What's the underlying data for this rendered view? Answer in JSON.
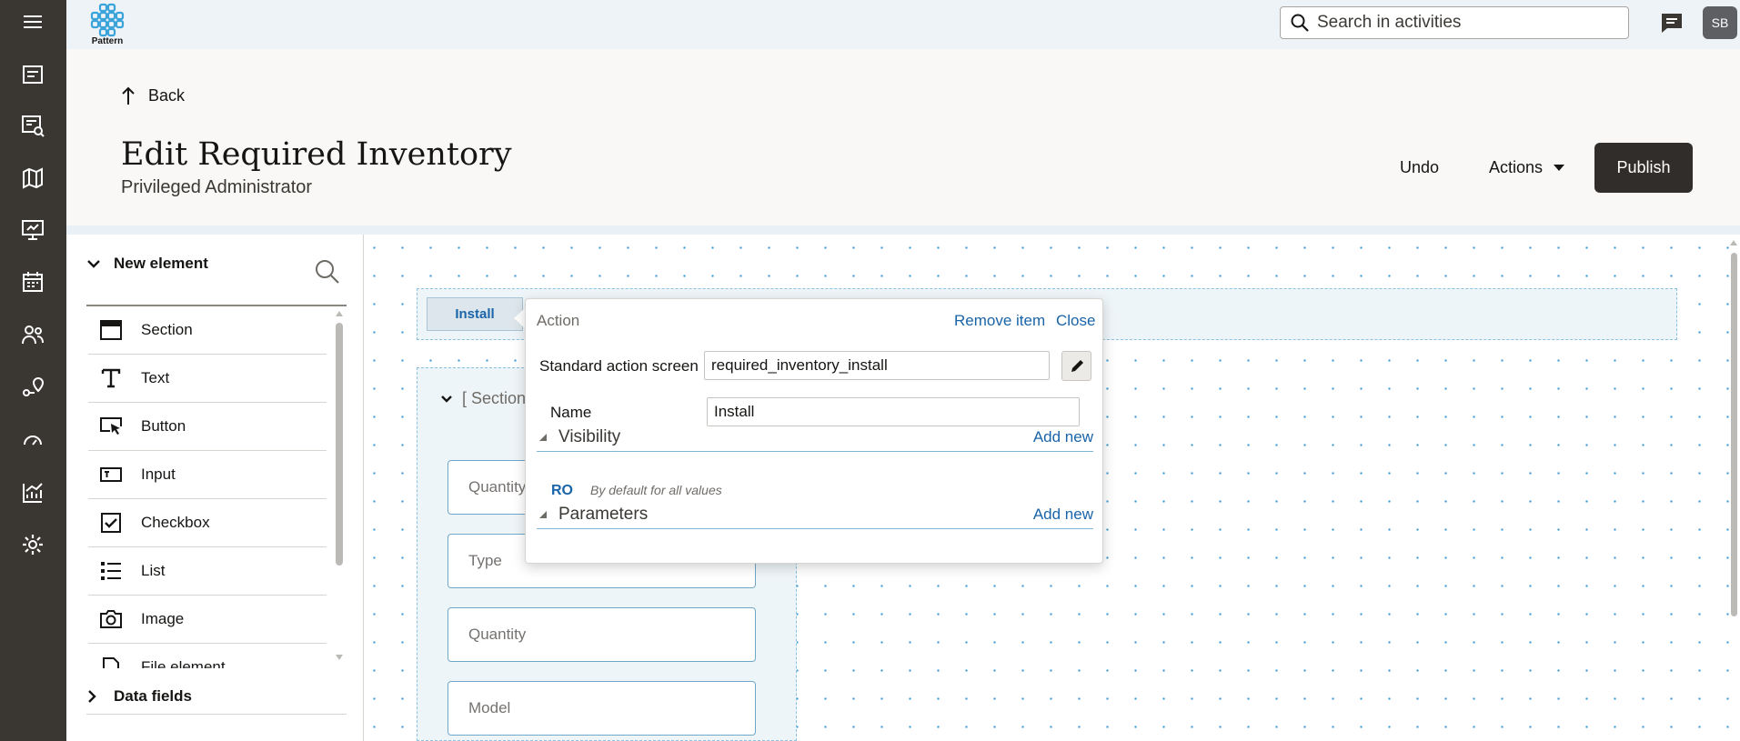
{
  "nav_rail": {
    "items": [
      {
        "icon": "hamburger-menu-icon"
      },
      {
        "icon": "activity-list-icon"
      },
      {
        "icon": "dispatch-search-icon"
      },
      {
        "icon": "map-icon"
      },
      {
        "icon": "presentation-icon"
      },
      {
        "icon": "calendar-icon"
      },
      {
        "icon": "resources-icon"
      },
      {
        "icon": "routing-icon"
      },
      {
        "icon": "gauge-icon"
      },
      {
        "icon": "analytics-icon"
      },
      {
        "icon": "settings-icon"
      }
    ]
  },
  "header": {
    "logo_text": "Pattern",
    "search_placeholder": "Search in activities",
    "avatar_initials": "SB"
  },
  "page": {
    "back_label": "Back",
    "title": "Edit Required Inventory",
    "subtitle": "Privileged Administrator",
    "undo_label": "Undo",
    "actions_label": "Actions",
    "publish_label": "Publish"
  },
  "palette": {
    "header": "New element",
    "items": [
      {
        "label": "Section",
        "icon": "section-icon"
      },
      {
        "label": "Text",
        "icon": "text-icon"
      },
      {
        "label": "Button",
        "icon": "button-icon"
      },
      {
        "label": "Input",
        "icon": "input-icon"
      },
      {
        "label": "Checkbox",
        "icon": "checkbox-icon"
      },
      {
        "label": "List",
        "icon": "list-icon"
      },
      {
        "label": "Image",
        "icon": "camera-icon"
      },
      {
        "label": "File element",
        "icon": "file-icon"
      }
    ],
    "data_fields_label": "Data fields"
  },
  "canvas": {
    "install_button_label": "Install",
    "section_header": "[ Section",
    "fields": [
      "Quantity",
      "Type",
      "Quantity",
      "Model"
    ]
  },
  "popup": {
    "title": "Action",
    "remove_label": "Remove item",
    "close_label": "Close",
    "standard_action_label": "Standard action screen",
    "standard_action_value": "required_inventory_install",
    "name_label": "Name",
    "name_value": "Install",
    "visibility_title": "Visibility",
    "parameters_title": "Parameters",
    "add_new_label": "Add new",
    "ro_label": "RO",
    "ro_description": "By default for all values"
  },
  "colors": {
    "rail": "#3a3632",
    "accent_link": "#1a64a8",
    "publish_bg": "#312d2a",
    "canvas_dot": "#3c9ad4"
  }
}
